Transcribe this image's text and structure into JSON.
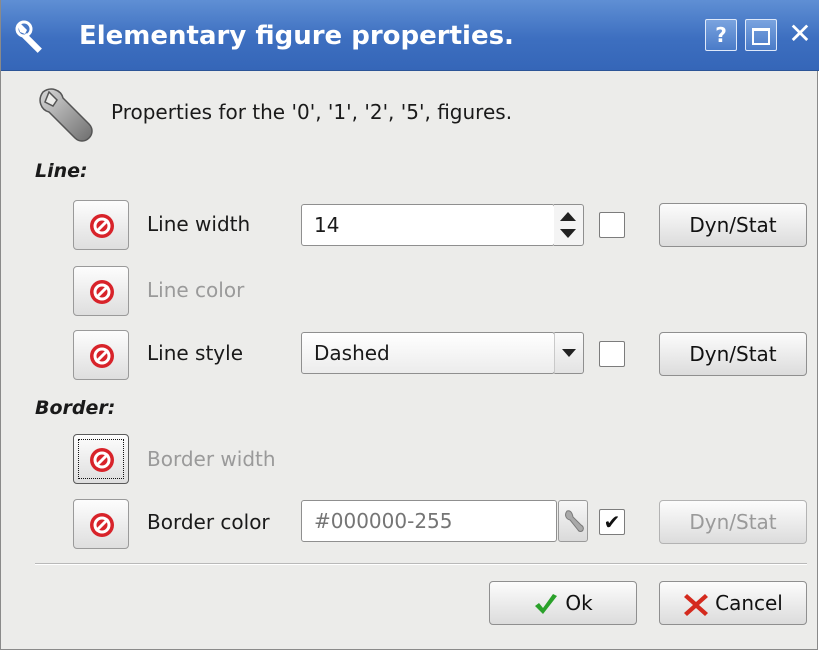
{
  "window": {
    "title": "Elementary figure properties.",
    "help_label": "?",
    "close_label": "✕"
  },
  "header": {
    "description": "Properties for the '0', '1', '2', '5',  figures."
  },
  "sections": {
    "line": "Line:",
    "border": "Border:"
  },
  "properties": {
    "line_width": {
      "label": "Line width",
      "value": "14",
      "dyn_stat_label": "Dyn/Stat",
      "checked": false
    },
    "line_color": {
      "label": "Line color"
    },
    "line_style": {
      "label": "Line style",
      "value": "Dashed",
      "dyn_stat_label": "Dyn/Stat",
      "checked": false
    },
    "border_width": {
      "label": "Border width"
    },
    "border_color": {
      "label": "Border color",
      "placeholder": "#000000-255",
      "dyn_stat_label": "Dyn/Stat",
      "checked": true,
      "check_mark": "✔"
    }
  },
  "footer": {
    "ok_label": "Ok",
    "cancel_label": "Cancel"
  },
  "colors": {
    "titlebar": "#3d6fc0",
    "reset_icon": "#d8232a",
    "ok_icon": "#2aa12a",
    "cancel_icon": "#d42a1e"
  }
}
